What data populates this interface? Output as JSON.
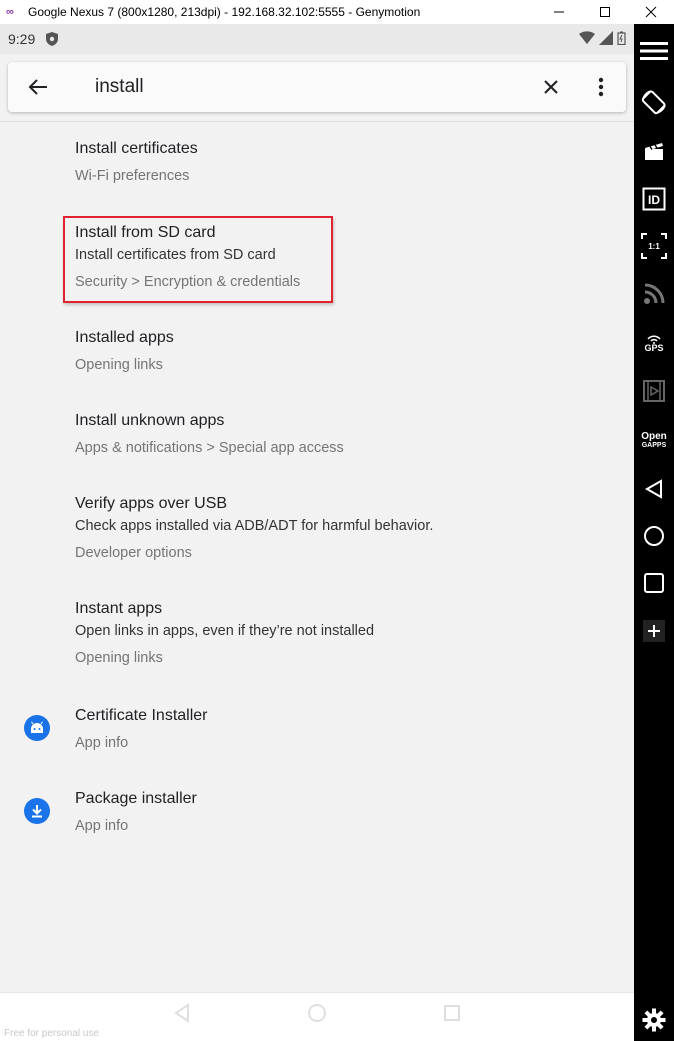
{
  "window": {
    "title": "Google Nexus 7 (800x1280, 213dpi) - 192.168.32.102:5555 - Genymotion"
  },
  "status_bar": {
    "time": "9:29"
  },
  "search": {
    "query": "install"
  },
  "results": [
    {
      "title": "Install certificates",
      "breadcrumb": "Wi-Fi preferences"
    },
    {
      "title": "Install from SD card",
      "summary": "Install certificates from SD card",
      "breadcrumb": "Security > Encryption & credentials"
    },
    {
      "title": "Installed apps",
      "breadcrumb": "Opening links"
    },
    {
      "title": "Install unknown apps",
      "breadcrumb": "Apps & notifications > Special app access"
    },
    {
      "title": "Verify apps over USB",
      "summary": "Check apps installed via ADB/ADT for harmful behavior.",
      "breadcrumb": "Developer options"
    },
    {
      "title": "Instant apps",
      "summary": "Open links in apps, even if they’re not installed",
      "breadcrumb": "Opening links"
    },
    {
      "title": "Certificate Installer",
      "breadcrumb": "App info",
      "icon": "android-icon"
    },
    {
      "title": "Package installer",
      "breadcrumb": "App info",
      "icon": "download-icon"
    }
  ],
  "watermark": "Free for personal use",
  "sidebar": {
    "gps_label": "GPS",
    "opengapps_label_1": "Open",
    "opengapps_label_2": "GAPPS",
    "id_label": "ID",
    "ratio_label": "1:1"
  },
  "colors": {
    "highlight": "#e0242f",
    "accent": "#1a73e8",
    "sidebar_bg": "#000000"
  }
}
